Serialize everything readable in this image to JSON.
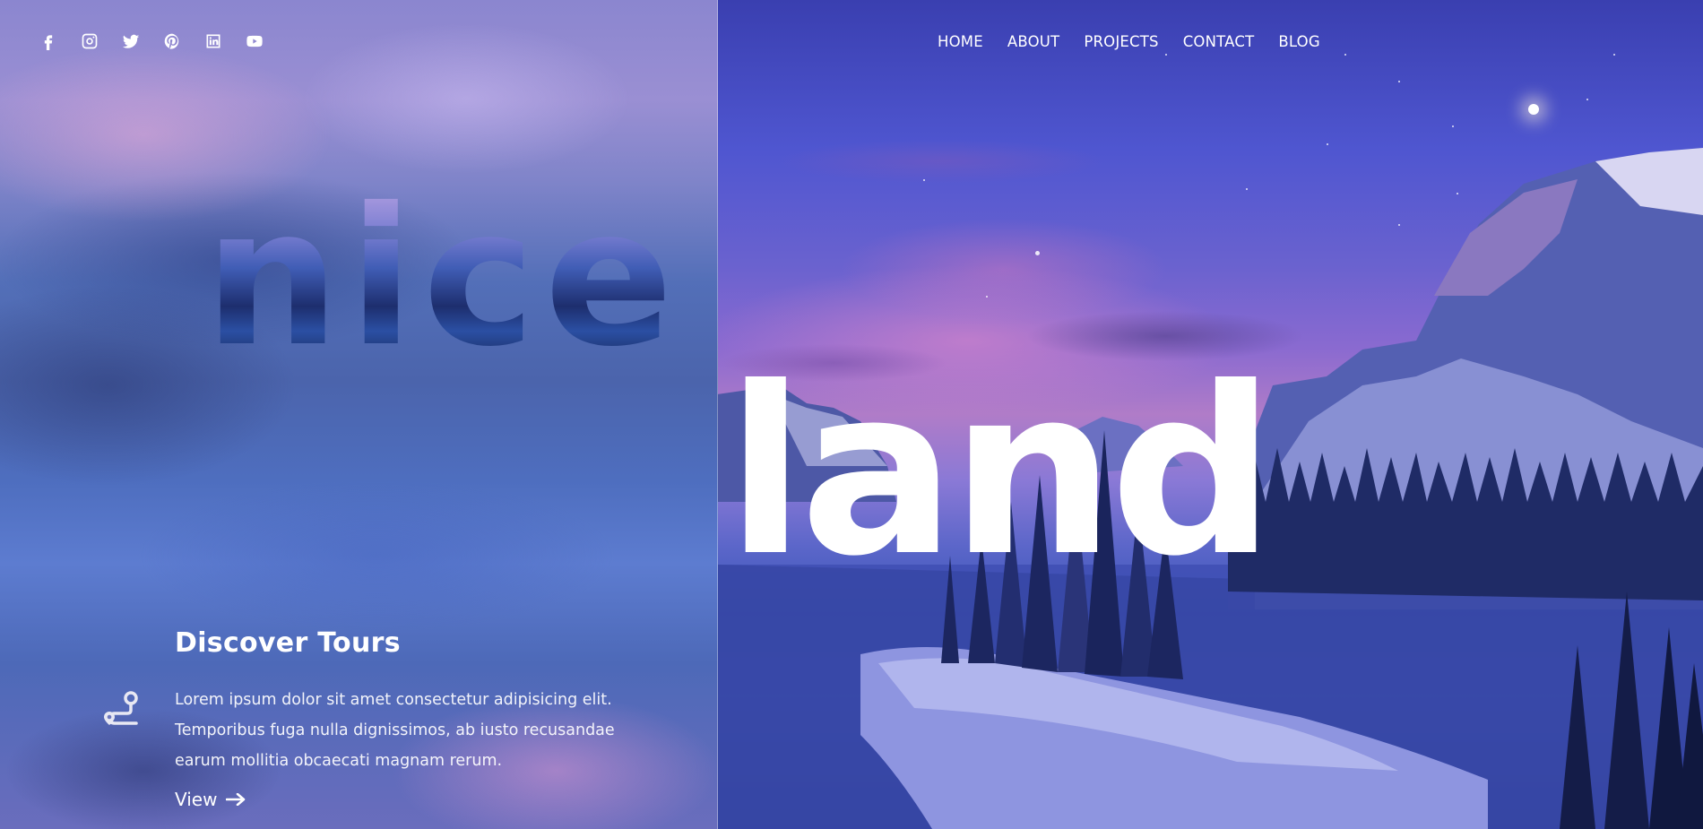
{
  "social": {
    "icons": [
      "facebook-icon",
      "instagram-icon",
      "twitter-icon",
      "pinterest-icon",
      "linkedin-icon",
      "youtube-icon"
    ]
  },
  "nav": {
    "items": [
      {
        "label": "HOME"
      },
      {
        "label": "ABOUT"
      },
      {
        "label": "PROJECTS"
      },
      {
        "label": "CONTACT"
      },
      {
        "label": "BLOG"
      }
    ]
  },
  "hero": {
    "word_left": "nice",
    "word_right": "land"
  },
  "discover": {
    "icon": "route-icon",
    "title": "Discover Tours",
    "text": "Lorem ipsum dolor sit amet consectetur adipisicing elit. Temporibus fuga nulla dignissimos, ab iusto recusandae earum mollitia obcaecati magnam rerum.",
    "link_label": "View",
    "link_icon": "arrow-right-icon"
  },
  "colors": {
    "sky_top": "#3a3fb0",
    "sky_pink": "#b07cc8",
    "panel": "#7f84c9",
    "text": "#ffffff"
  }
}
